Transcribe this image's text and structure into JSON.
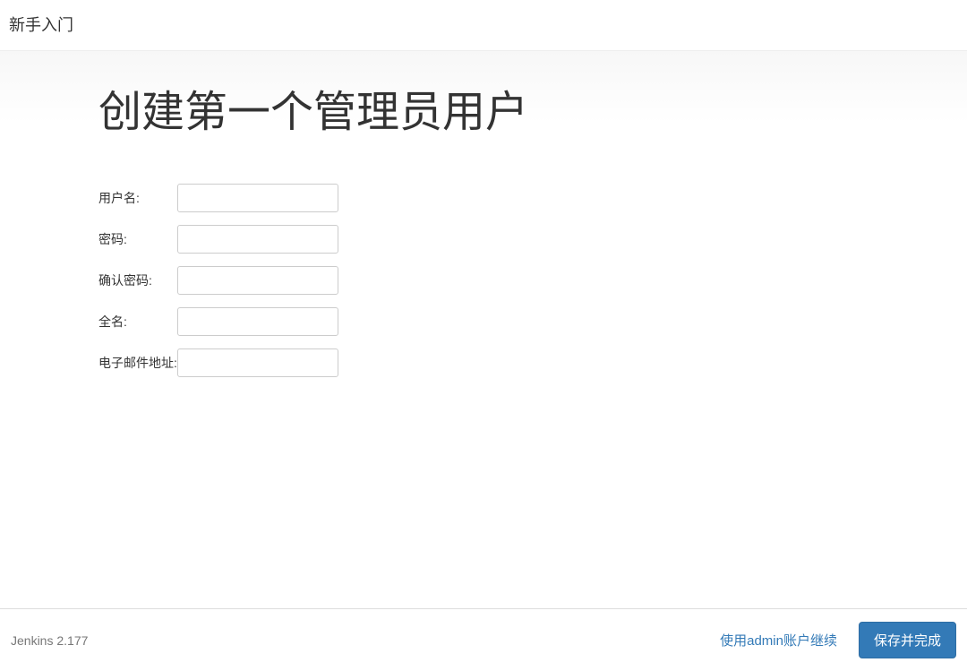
{
  "header": {
    "title": "新手入门"
  },
  "page": {
    "heading": "创建第一个管理员用户"
  },
  "form": {
    "username": {
      "label": "用户名:",
      "value": ""
    },
    "password": {
      "label": "密码:",
      "value": ""
    },
    "confirm_password": {
      "label": "确认密码:",
      "value": ""
    },
    "fullname": {
      "label": "全名:",
      "value": ""
    },
    "email": {
      "label": "电子邮件地址:",
      "value": ""
    }
  },
  "footer": {
    "version": "Jenkins 2.177",
    "continue_as_admin": "使用admin账户继续",
    "save_and_finish": "保存并完成"
  }
}
